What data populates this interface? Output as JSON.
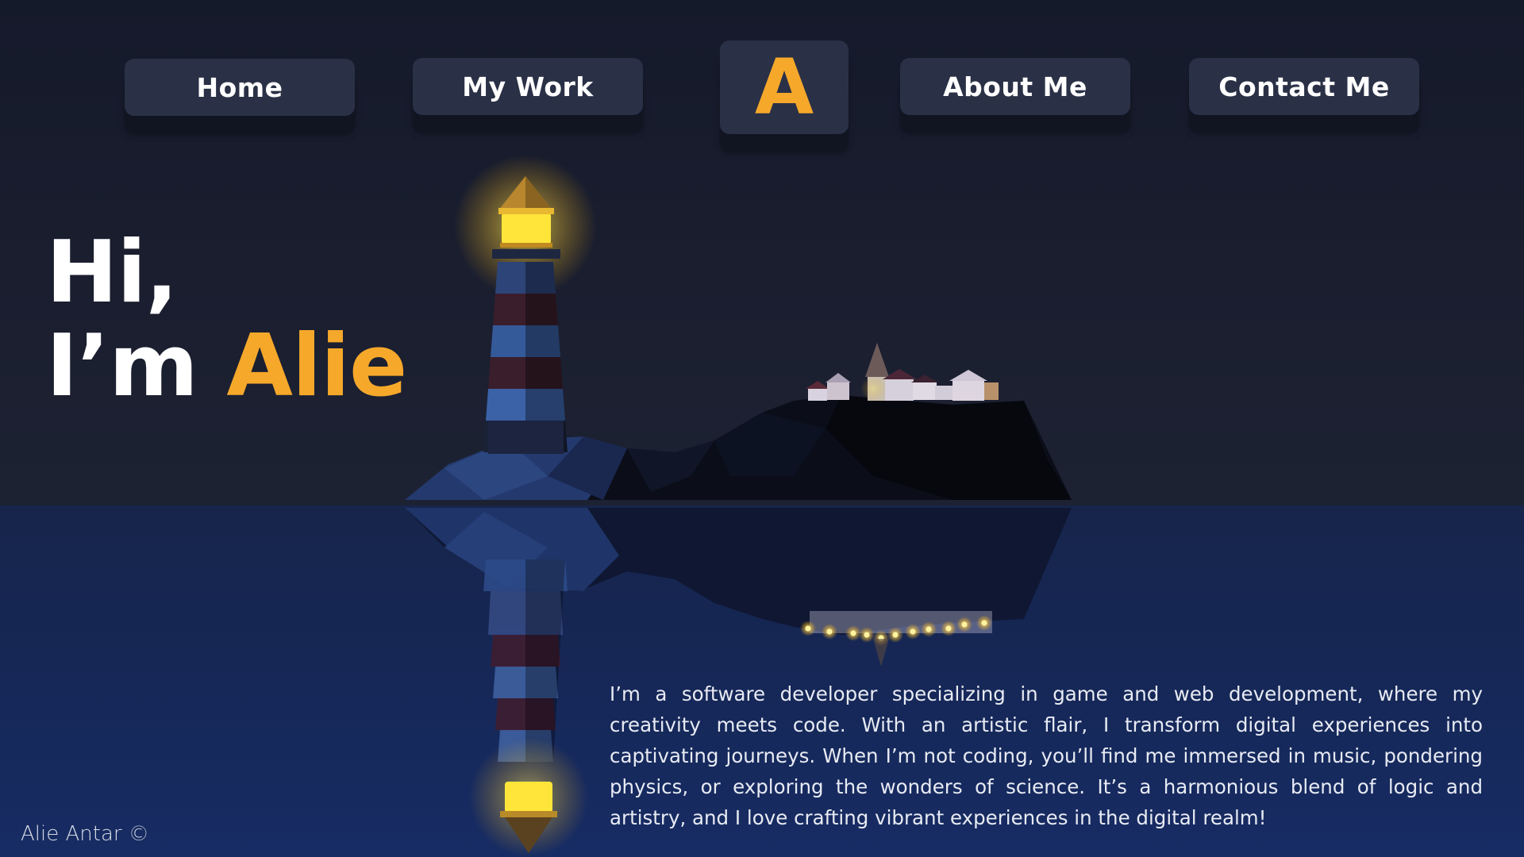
{
  "nav": {
    "home_label": "Home",
    "work_label": "My Work",
    "logo_label": "A",
    "about_label": "About Me",
    "contact_label": "Contact Me"
  },
  "hero": {
    "line1": "Hi,",
    "line2_prefix": "I’m ",
    "line2_name": "Alie"
  },
  "description": "I’m a software developer specializing in game and web development, where my creativity meets code. With an artistic flair, I transform digital experiences into captivating journeys. When I’m not coding, you’ll find me immersed in music, pondering physics, or exploring the wonders of science. It’s a harmonious blend of logic and artistry, and I love crafting vibrant experiences in the digital realm!",
  "footer": {
    "copyright": "Alie Antar ©"
  },
  "colors": {
    "accent": "#f6a82b",
    "button_bg": "#2a3146",
    "background": "#171b2b",
    "water": "#17295a",
    "lighthouse_glow": "#ffe13a"
  },
  "scene": {
    "description_icon": "lighthouse-island-illustration"
  }
}
